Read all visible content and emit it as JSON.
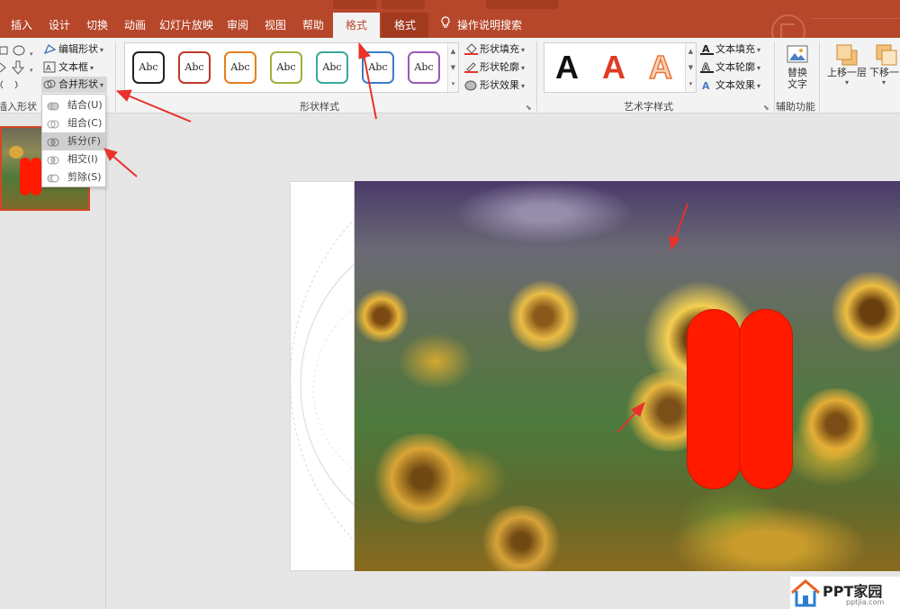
{
  "tabs": {
    "insert": "插入",
    "design": "设计",
    "transitions": "切换",
    "animations": "动画",
    "slideshow": "幻灯片放映",
    "review": "审阅",
    "view": "视图",
    "help": "帮助",
    "format_active": "格式",
    "format_picture": "格式",
    "search": "操作说明搜索"
  },
  "ribbon": {
    "insert_shapes": {
      "label": "插入形状",
      "edit_shape": "编辑形状",
      "textbox": "文本框",
      "merge_shapes": "合并形状"
    },
    "shape_styles": {
      "label": "形状样式",
      "sample_text": "Abc",
      "swatch_colors": [
        "#222222",
        "#c0392b",
        "#e67e22",
        "#9ab33f",
        "#3aa89a",
        "#3b7dc4",
        "#9b59b6"
      ],
      "fill": "形状填充",
      "outline": "形状轮廓",
      "effects": "形状效果"
    },
    "wordart": {
      "label": "艺术字样式",
      "sample_letter": "A",
      "letter_colors": [
        "#111111",
        "#e03b24",
        "#f0a060"
      ],
      "text_fill": "文本填充",
      "text_outline": "文本轮廓",
      "text_effects": "文本效果"
    },
    "accessibility": {
      "label": "辅助功能",
      "alt_text_line1": "替换",
      "alt_text_line2": "文字"
    },
    "arrange": {
      "bring_forward": "上移一层",
      "send_backward": "下移一"
    }
  },
  "merge_menu": {
    "items": [
      "结合(U)",
      "组合(C)",
      "拆分(F)",
      "相交(I)",
      "剪除(S)"
    ],
    "highlighted": "拆分(F)"
  },
  "watermark": {
    "brand": "PPT家园",
    "url": "pptjia.com"
  },
  "colors": {
    "accent": "#b7472a",
    "shape_red": "#ff1a00",
    "annotation_arrow": "#e8322a"
  }
}
